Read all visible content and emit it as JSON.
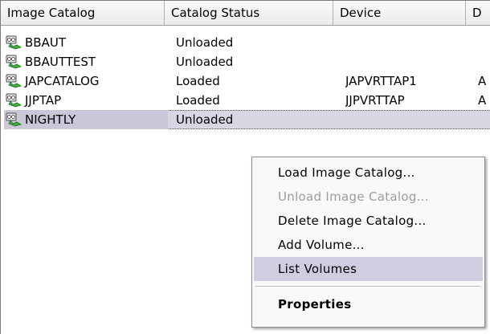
{
  "columns": [
    "Image Catalog",
    "Catalog Status",
    "Device",
    "D"
  ],
  "rows": [
    {
      "name": "BBAUT",
      "status": "Unloaded",
      "device": "",
      "extra": ""
    },
    {
      "name": "BBAUTTEST",
      "status": "Unloaded",
      "device": "",
      "extra": ""
    },
    {
      "name": "JAPCATALOG",
      "status": "Loaded",
      "device": "JAPVRTTAP1",
      "extra": "A"
    },
    {
      "name": "JJPTAP",
      "status": "Loaded",
      "device": "JJPVRTTAP",
      "extra": "A"
    },
    {
      "name": "NIGHTLY",
      "status": "Unloaded",
      "device": "",
      "extra": ""
    }
  ],
  "row_icon": "catalog-icon",
  "selected_row": "NIGHTLY",
  "context_menu": {
    "load": "Load Image Catalog...",
    "unload": "Unload Image Catalog...",
    "delete": "Delete Image Catalog...",
    "add_volume": "Add Volume...",
    "list_volumes": "List Volumes",
    "properties": "Properties"
  },
  "colors": {
    "selection": "#d7d6e2",
    "menu_highlight": "#cfcde0",
    "disabled_text": "#9c9c9c"
  }
}
